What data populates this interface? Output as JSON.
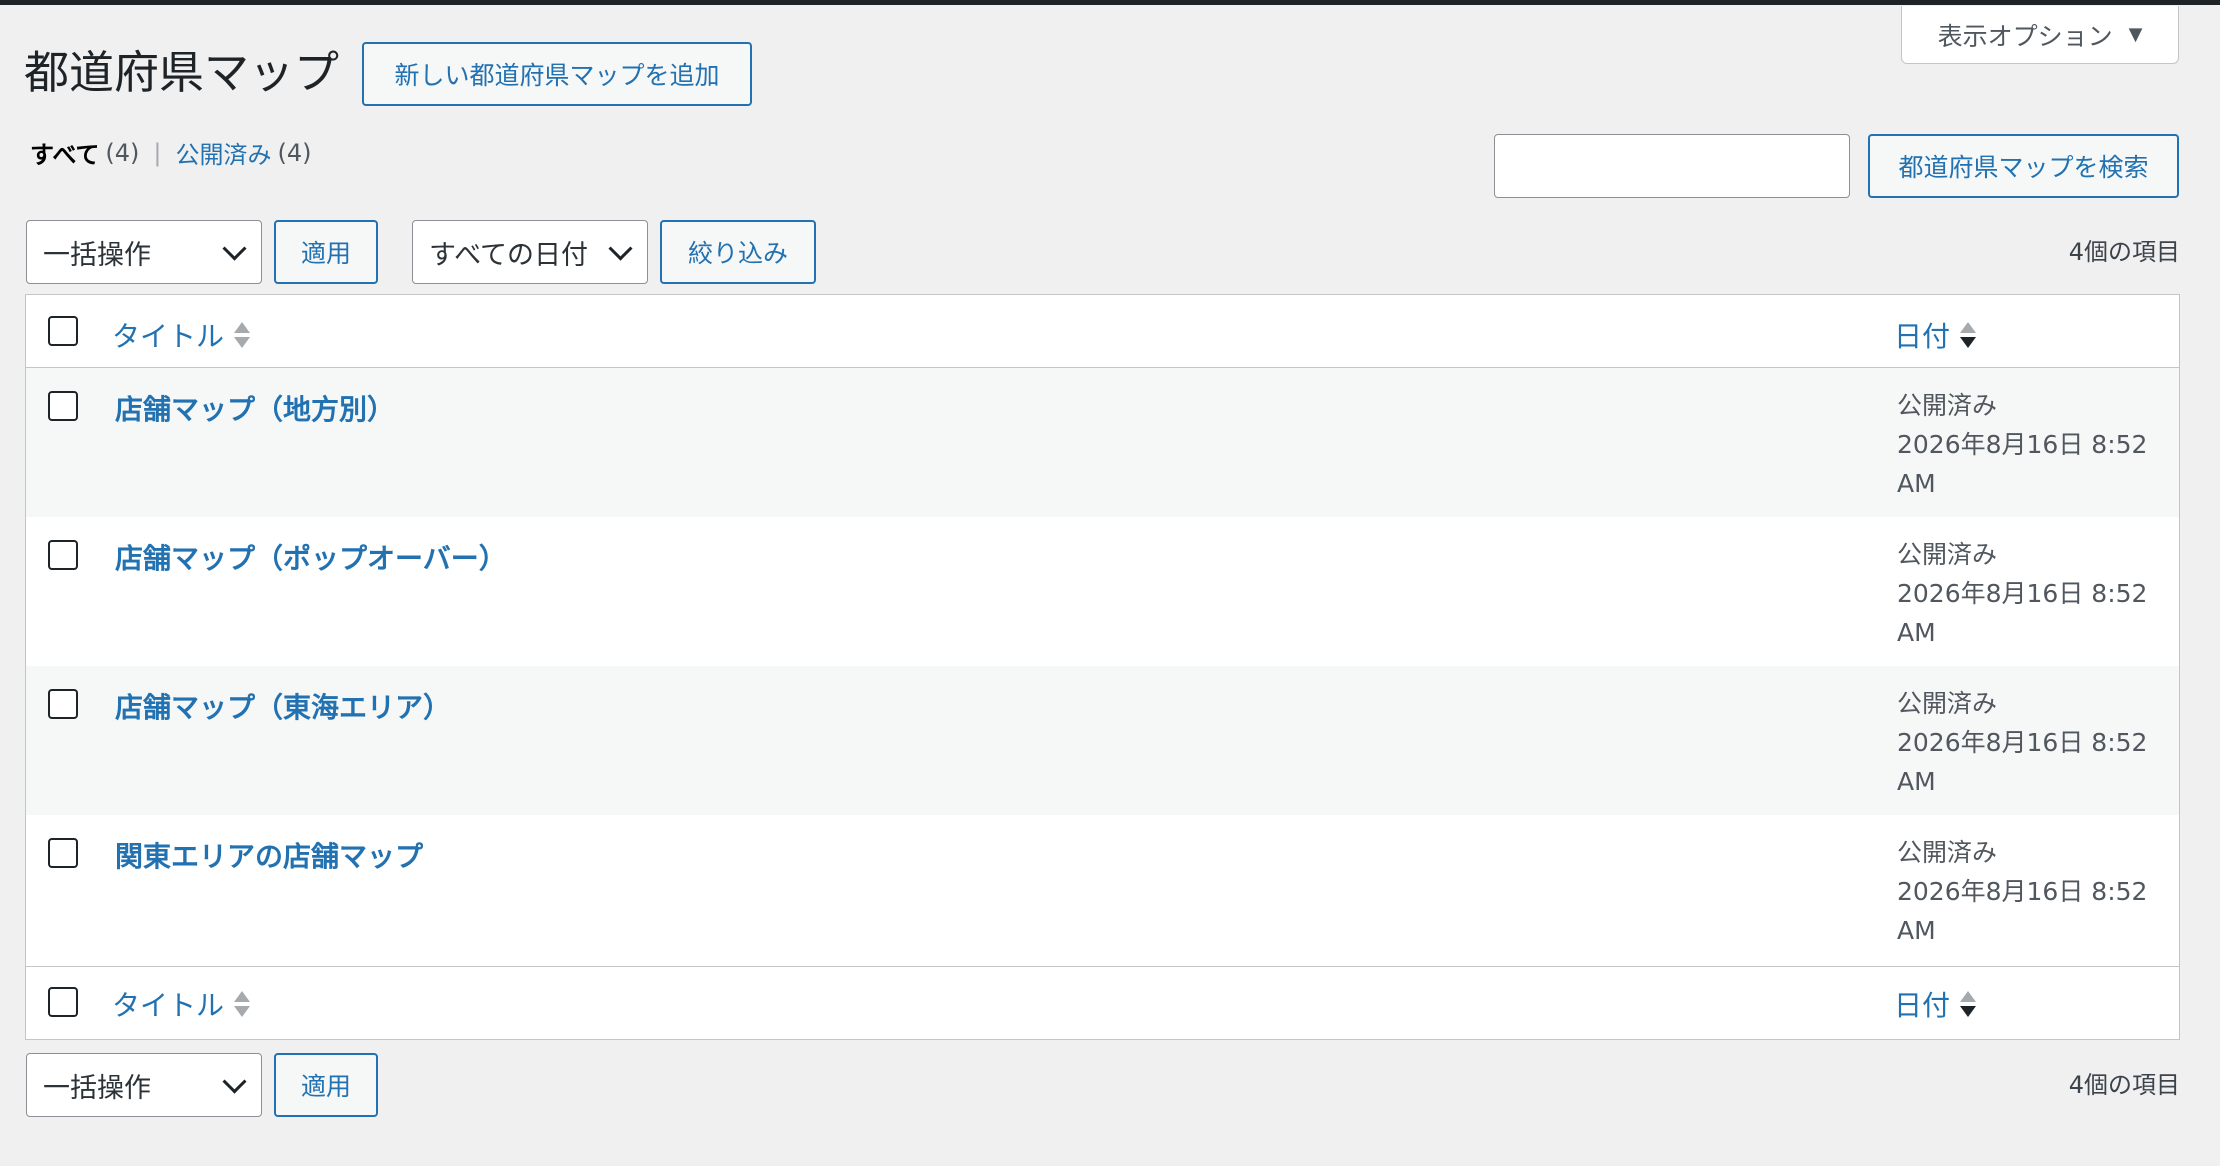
{
  "screen_options": {
    "label": "表示オプション",
    "arrow": "▼"
  },
  "page": {
    "title": "都道府県マップ",
    "add_new_label": "新しい都道府県マップを追加"
  },
  "views": {
    "all_label": "すべて",
    "all_count": "(4)",
    "separator": "|",
    "published_label": "公開済み",
    "published_count": "(4)"
  },
  "search": {
    "value": "",
    "button_label": "都道府県マップを検索"
  },
  "tablenav_top": {
    "bulk_action": "一括操作",
    "apply_label": "適用",
    "date_filter": "すべての日付",
    "filter_label": "絞り込み",
    "items_count": "4個の項目"
  },
  "table": {
    "columns": {
      "title": "タイトル",
      "date": "日付"
    },
    "rows": [
      {
        "title": "店舗マップ（地方別）",
        "status": "公開済み",
        "date": "2026年8月16日 8:52",
        "time_suffix": "AM"
      },
      {
        "title": "店舗マップ（ポップオーバー）",
        "status": "公開済み",
        "date": "2026年8月16日 8:52",
        "time_suffix": "AM"
      },
      {
        "title": "店舗マップ（東海エリア）",
        "status": "公開済み",
        "date": "2026年8月16日 8:52",
        "time_suffix": "AM"
      },
      {
        "title": "関東エリアの店舗マップ",
        "status": "公開済み",
        "date": "2026年8月16日 8:52",
        "time_suffix": "AM"
      }
    ]
  },
  "tablenav_bottom": {
    "bulk_action": "一括操作",
    "apply_label": "適用",
    "items_count": "4個の項目"
  },
  "colors": {
    "link": "#2271b1",
    "background": "#f0f0f1",
    "row_alt": "#f6f7f7",
    "border": "#c3c4c7"
  }
}
